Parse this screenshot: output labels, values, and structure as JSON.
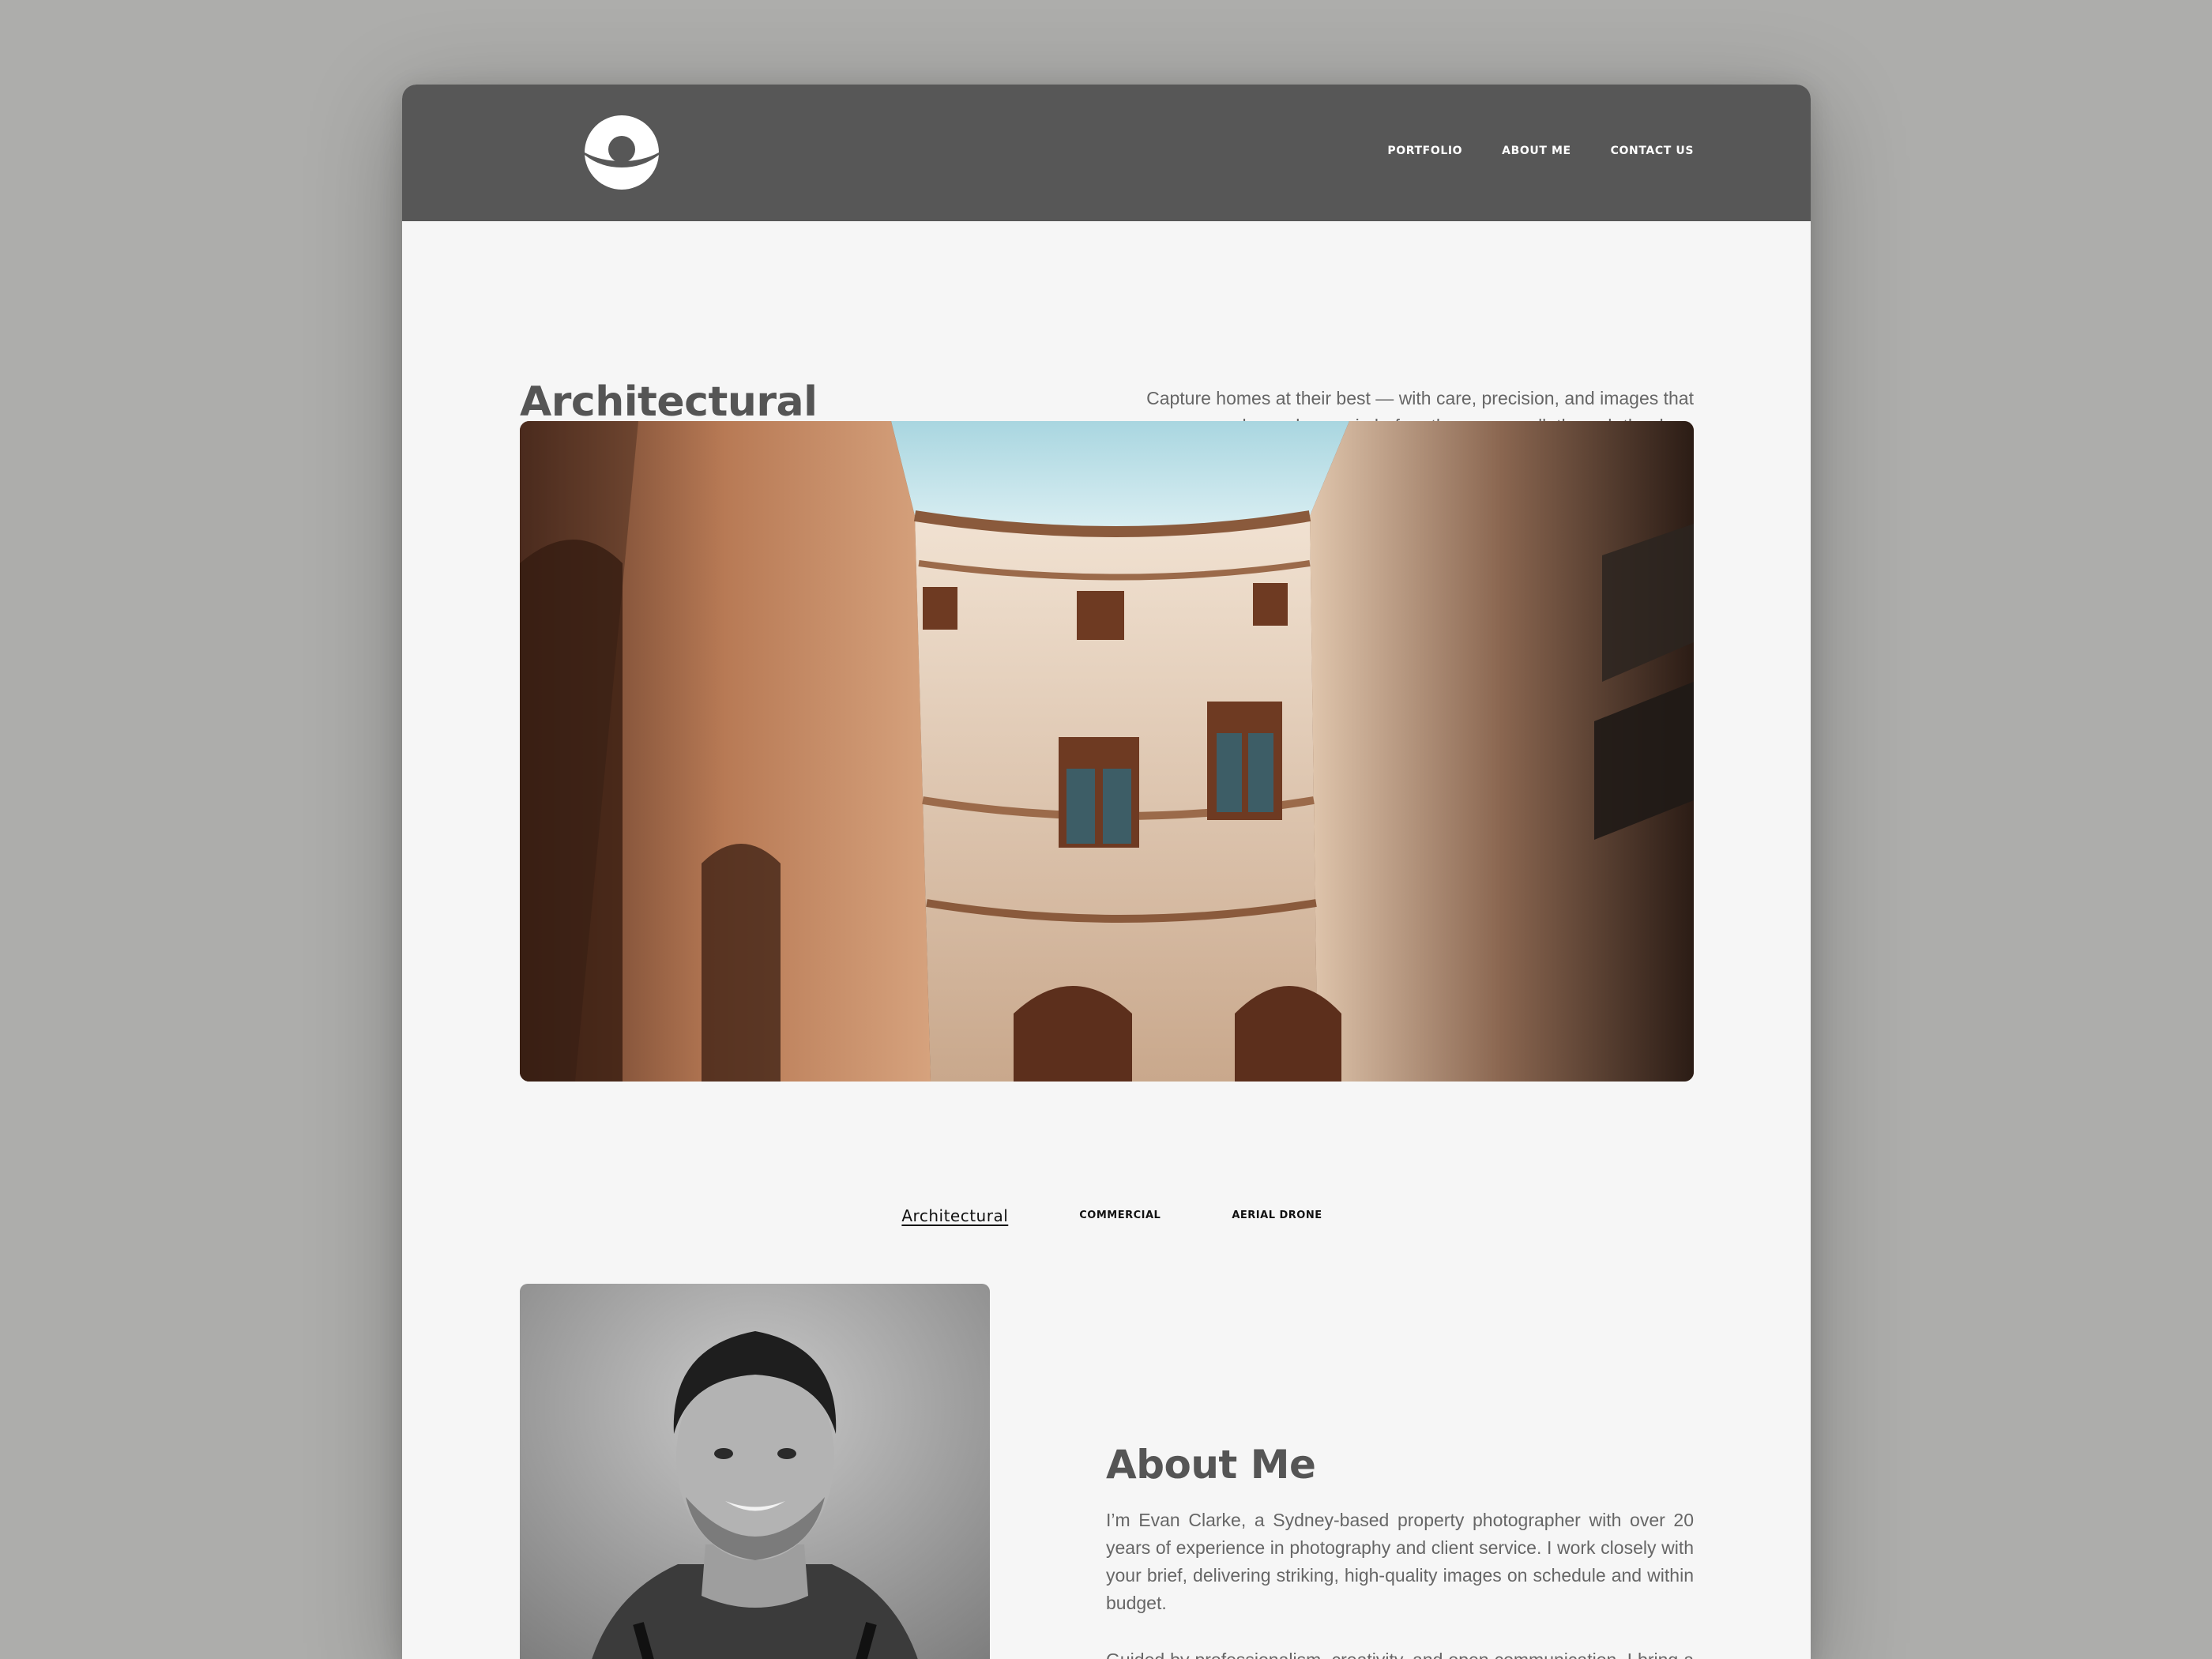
{
  "header": {
    "logo_icon": "camera-aperture-logo-icon",
    "nav": [
      {
        "label": "PORTFOLIO"
      },
      {
        "label": "ABOUT ME"
      },
      {
        "label": "CONTACT US"
      }
    ]
  },
  "hero": {
    "title": "Architectural",
    "description": "Capture homes at their best — with care, precision, and images that welcome buyers in before they even walk through the door.",
    "image_alt": "Courtyard view looking up at ornate classical building facades"
  },
  "tabs": [
    {
      "label": "Architectural",
      "active": true
    },
    {
      "label": "COMMERCIAL",
      "active": false
    },
    {
      "label": "AERIAL DRONE",
      "active": false
    }
  ],
  "about": {
    "title": "About Me",
    "paragraph_1": "I’m Evan Clarke, a Sydney-based property photographer with over 20 years of experience in photography and client service. I work closely with your brief, delivering striking, high-quality images on schedule and within budget.",
    "paragraph_2": "Guided by professionalism, creativity, and open communication, I bring a calm yet detail-focused approach—from styling and shooting to editing and final delivery.",
    "portrait_alt": "Black and white portrait of a smiling man"
  },
  "colors": {
    "page_background": "#adadab",
    "header_background": "#575757",
    "content_background": "#f6f6f6",
    "heading_text": "#555555",
    "body_text": "#666666"
  }
}
